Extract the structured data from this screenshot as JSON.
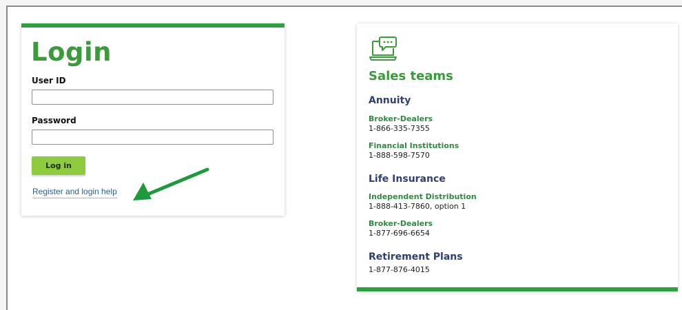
{
  "login": {
    "title": "Login",
    "user_id_label": "User ID",
    "user_id_value": "",
    "password_label": "Password",
    "password_value": "",
    "login_button": "Log in",
    "help_link": "Register and login help"
  },
  "sales": {
    "title": "Sales teams",
    "icon": "chat-laptop-icon",
    "sections": [
      {
        "heading": "Annuity",
        "contacts": [
          {
            "name": "Broker-Dealers",
            "phone": "1-866-335-7355"
          },
          {
            "name": "Financial Institutions",
            "phone": "1-888-598-7570"
          }
        ]
      },
      {
        "heading": "Life Insurance",
        "contacts": [
          {
            "name": "Independent Distribution",
            "phone": "1-888-413-7860, option 1"
          },
          {
            "name": "Broker-Dealers",
            "phone": "1-877-696-6654"
          }
        ]
      },
      {
        "heading": "Retirement Plans",
        "phone": "1-877-876-4015"
      }
    ]
  },
  "colors": {
    "brand_green": "#2ea043",
    "title_green": "#3a9b3a",
    "button_green": "#8fcb3f",
    "heading_navy": "#2d3f75",
    "link_blue": "#2b5f8c",
    "arrow_green": "#1e9a3c"
  }
}
